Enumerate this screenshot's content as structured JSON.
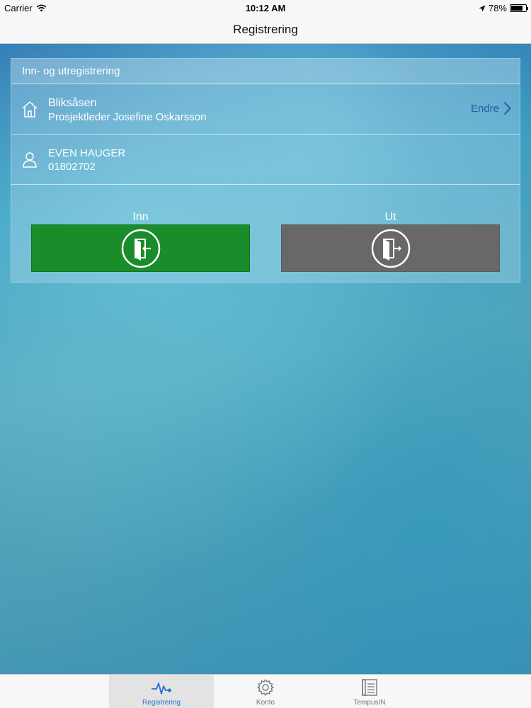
{
  "status_bar": {
    "carrier": "Carrier",
    "time": "10:12 AM",
    "battery": "78%",
    "battery_level": 0.78
  },
  "nav": {
    "title": "Registrering"
  },
  "card": {
    "header": "Inn- og utregistrering",
    "location": {
      "icon": "home-icon",
      "name": "Bliksåsen",
      "subtitle": "Prosjektleder Josefine Oskarsson",
      "action_label": "Endre"
    },
    "person": {
      "icon": "user-icon",
      "name": "EVEN HAUGER",
      "id": "01802702"
    },
    "buttons": {
      "inn_label": "Inn",
      "ut_label": "Ut",
      "inn_color": "#1a8c2a",
      "ut_color": "#686868"
    }
  },
  "tabs": [
    {
      "label": "Registrering",
      "icon": "activity-icon",
      "active": true
    },
    {
      "label": "Konto",
      "icon": "gear-icon",
      "active": false
    },
    {
      "label": "TempusIN",
      "icon": "document-icon",
      "active": false
    }
  ],
  "colors": {
    "accent": "#2d6fd6",
    "link": "#1f5fa5"
  }
}
